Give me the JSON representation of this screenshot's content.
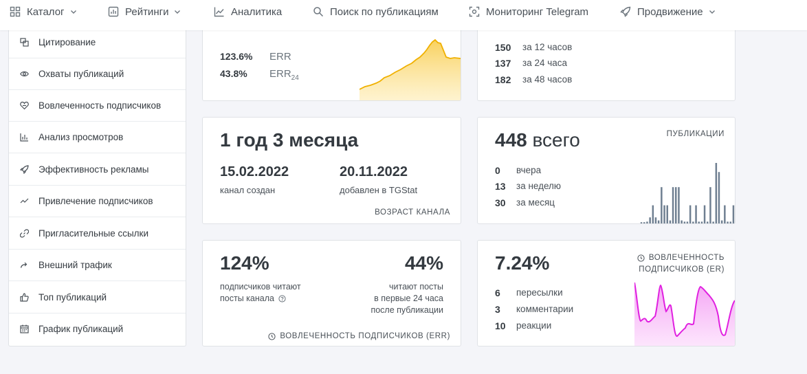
{
  "nav": {
    "catalog": "Каталог",
    "ratings": "Рейтинги",
    "analytics": "Аналитика",
    "search": "Поиск по публикациям",
    "monitoring": "Мониторинг Telegram",
    "promotion": "Продвижение"
  },
  "sidebar": {
    "items": [
      {
        "label": "Цитирование",
        "icon": "quote-icon"
      },
      {
        "label": "Охваты публикаций",
        "icon": "eye-icon"
      },
      {
        "label": "Вовлеченность подписчиков",
        "icon": "engagement-icon"
      },
      {
        "label": "Анализ просмотров",
        "icon": "bar-chart-icon"
      },
      {
        "label": "Эффективность рекламы",
        "icon": "rocket-icon"
      },
      {
        "label": "Привлечение подписчиков",
        "icon": "trend-icon"
      },
      {
        "label": "Пригласительные ссылки",
        "icon": "link-icon"
      },
      {
        "label": "Внешний трафик",
        "icon": "share-icon"
      },
      {
        "label": "Топ публикаций",
        "icon": "thumbs-up-icon"
      },
      {
        "label": "График публикаций",
        "icon": "calendar-icon"
      }
    ]
  },
  "err_card": {
    "err_value": "123.6%",
    "err_label": "ERR",
    "err24_value": "43.8%",
    "err24_label": "ERR",
    "err24_sub": "24"
  },
  "views_card": {
    "rows": [
      {
        "value": "150",
        "label": "за 12 часов"
      },
      {
        "value": "137",
        "label": "за 24 часа"
      },
      {
        "value": "182",
        "label": "за 48 часов"
      }
    ]
  },
  "age_card": {
    "age": "1 год 3 месяца",
    "created_date": "15.02.2022",
    "created_label": "канал создан",
    "added_date": "20.11.2022",
    "added_label": "добавлен в TGStat",
    "footer": "ВОЗРАСТ КАНАЛА"
  },
  "posts_card": {
    "total": "448",
    "total_label": "всего",
    "title": "ПУБЛИКАЦИИ",
    "rows": [
      {
        "value": "0",
        "label": "вчера"
      },
      {
        "value": "13",
        "label": "за неделю"
      },
      {
        "value": "30",
        "label": "за месяц"
      }
    ],
    "bars": [
      0.02,
      0.02,
      0.03,
      0.1,
      0.3,
      0.1,
      0.05,
      0.6,
      0.3,
      0.3,
      0.05,
      0.6,
      0.6,
      0.6,
      0.05,
      0.03,
      0.03,
      0.3,
      0.03,
      0.3,
      0.03,
      0.03,
      0.3,
      0.03,
      0.6,
      0.03,
      1.0,
      0.85,
      0.05,
      0.3,
      0.03,
      0.03,
      0.3
    ]
  },
  "err_percent_card": {
    "left_value": "124%",
    "left_text_1": "подписчиков читают",
    "left_text_2": "посты канала",
    "right_value": "44%",
    "right_text_1": "читают посты",
    "right_text_2": "в первые 24 часа",
    "right_text_3": "после публикации",
    "footer": "ВОВЛЕЧЕННОСТЬ ПОДПИСЧИКОВ (ERR)"
  },
  "er_card": {
    "value": "7.24%",
    "title_1": "ВОВЛЕЧЕННОСТЬ",
    "title_2": "ПОДПИСЧИКОВ (ER)",
    "rows": [
      {
        "value": "6",
        "label": "пересылки"
      },
      {
        "value": "3",
        "label": "комментарии"
      },
      {
        "value": "10",
        "label": "реакции"
      }
    ]
  },
  "colors": {
    "accent_yellow": "#f5b915",
    "accent_magenta": "#e83ee8",
    "bar_gray": "#6f7f91"
  }
}
